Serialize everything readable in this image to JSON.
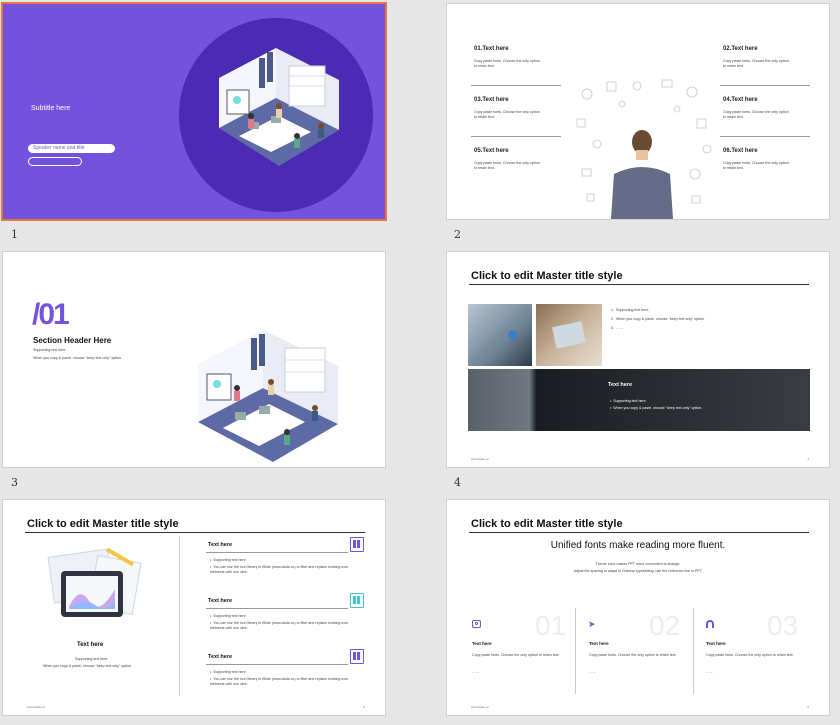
{
  "colors": {
    "accent": "#7453dc",
    "selected_border": "#e8763a",
    "teal": "#44c4d6"
  },
  "slide_numbers": [
    "1",
    "2",
    "3",
    "4",
    "5",
    "6"
  ],
  "slide1": {
    "subtitle": "Subtitle here",
    "speaker": "Speaker name and title"
  },
  "slide2": {
    "items": [
      {
        "title": "01.Text here",
        "body": "Copy paste fonts. Choose the only option to retain text."
      },
      {
        "title": "02.Text here",
        "body": "Copy paste fonts. Choose the only option to retain text."
      },
      {
        "title": "03.Text here",
        "body": "Copy paste fonts. Choose the only option to retain text."
      },
      {
        "title": "04.Text here",
        "body": "Copy paste fonts. Choose the only option to retain text."
      },
      {
        "title": "05.Text here",
        "body": "Copy paste fonts. Choose the only option to retain text."
      },
      {
        "title": "06.Text here",
        "body": "Copy paste fonts. Choose the only option to retain text."
      }
    ]
  },
  "slide3": {
    "number": "/01",
    "header": "Section Header Here",
    "line1": "Supporting text here.",
    "line2": "When you copy & paste, choose \"keep text only\" option."
  },
  "slide4": {
    "title": "Click to edit Master title style",
    "list": [
      "Supporting text here.",
      "When you copy & paste, choose \"keep text only\" option.",
      "……"
    ],
    "band_title": "Text here",
    "band_bullets": [
      "Supporting text here.",
      "When you copy & paste, choose \"keep text only\" option."
    ],
    "footer": "www.islide.cc",
    "page": "4"
  },
  "slide5": {
    "title": "Click to edit Master title style",
    "left_title": "Text here",
    "left_line1": "Supporting text here.",
    "left_line2": "When you copy & paste, choose \"keep text only\" option.",
    "blocks": [
      {
        "title": "Text here",
        "b1": "Supporting text here.",
        "b2": "You can use the icon library in iSlide (www.islide.cc) to filter and replace existing icon elements with one click."
      },
      {
        "title": "Text here",
        "b1": "Supporting text here.",
        "b2": "You can use the icon library in iSlide (www.islide.cc) to filter and replace existing icon elements with one click."
      },
      {
        "title": "Text here",
        "b1": "Supporting text here.",
        "b2": "You can use the icon library in iSlide (www.islide.cc) to filter and replace existing icon elements with one click."
      }
    ],
    "footer": "www.islide.cc",
    "page": "5"
  },
  "slide6": {
    "title": "Click to edit Master title style",
    "headline": "Unified fonts make reading more fluent.",
    "sub1": "Theme color makes PPT more convenient to change.",
    "sub2": "Adjust the spacing to adapt to Chinese typesetting, use the reference line in PPT.",
    "cols": [
      {
        "big": "01",
        "title": "Text here",
        "body": "Copy paste fonts. Choose the only option to retain text.",
        "more": "……"
      },
      {
        "big": "02",
        "title": "Text here",
        "body": "Copy paste fonts. Choose the only option to retain text.",
        "more": "……"
      },
      {
        "big": "03",
        "title": "Text here",
        "body": "Copy paste fonts. Choose the only option to retain text.",
        "more": "……"
      }
    ],
    "footer": "www.islide.cc",
    "page": "6"
  }
}
